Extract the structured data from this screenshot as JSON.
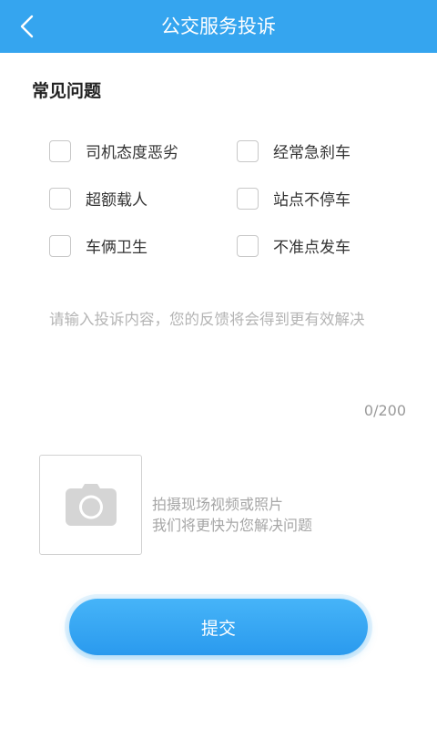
{
  "header": {
    "title": "公交服务投诉",
    "back_icon": "chevron-left-icon",
    "background": "#35a5ef"
  },
  "common_issues": {
    "title": "常见问题",
    "options": [
      {
        "label": "司机态度恶劣",
        "checked": false
      },
      {
        "label": "经常急刹车",
        "checked": false
      },
      {
        "label": "超额载人",
        "checked": false
      },
      {
        "label": "站点不停车",
        "checked": false
      },
      {
        "label": "车俩卫生",
        "checked": false
      },
      {
        "label": "不准点发车",
        "checked": false
      }
    ]
  },
  "complaint": {
    "placeholder": "请输入投诉内容，您的反馈将会得到更有效解决",
    "value": "",
    "counter": "0/200"
  },
  "upload": {
    "icon": "camera-icon",
    "hint_line1": "拍摄现场视频或照片",
    "hint_line2": "我们将更快为您解决问题"
  },
  "submit": {
    "label": "提交",
    "color": "#35a5ef"
  }
}
